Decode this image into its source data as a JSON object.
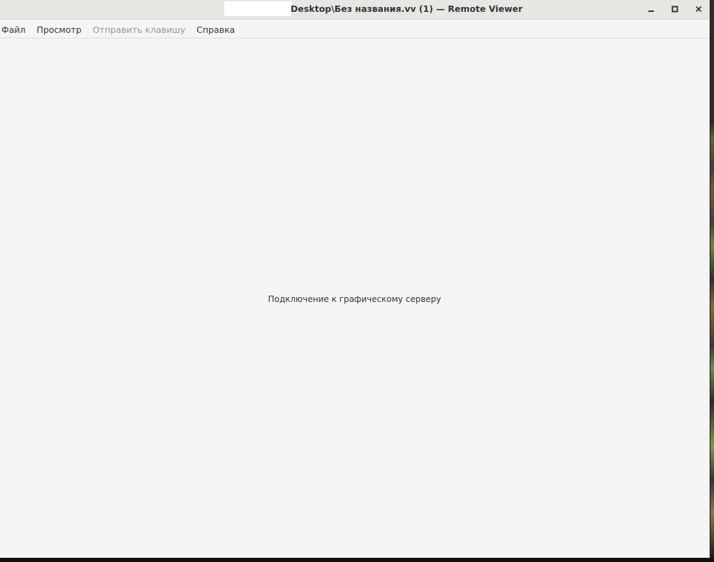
{
  "window": {
    "title": "Desktop\\Без названия.vv (1) — Remote Viewer",
    "controls": {
      "minimize": "—",
      "maximize": "□",
      "close": "✕"
    }
  },
  "menu": {
    "items": [
      {
        "label": "Файл",
        "enabled": true
      },
      {
        "label": "Просмотр",
        "enabled": true
      },
      {
        "label": "Отправить клавишу",
        "enabled": false
      },
      {
        "label": "Справка",
        "enabled": true
      }
    ]
  },
  "content": {
    "status_text": "Подключение к графическому серверу"
  }
}
